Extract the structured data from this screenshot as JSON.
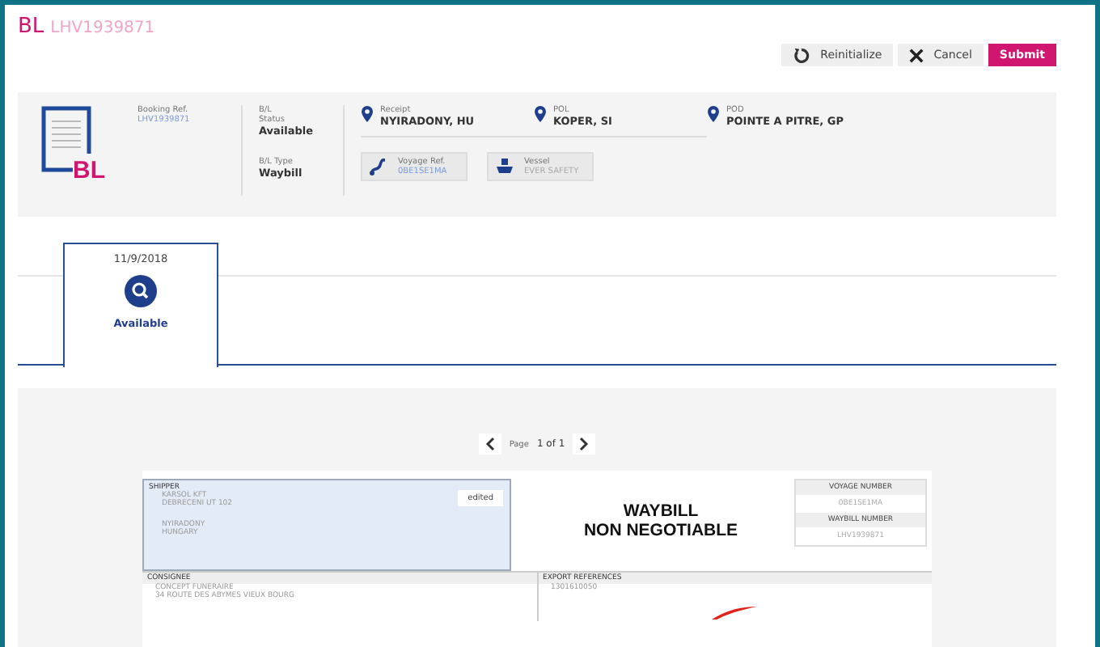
{
  "header": {
    "prefix": "BL",
    "reference": "LHV1939871"
  },
  "actions": [
    {
      "kind": "reset",
      "label": "Reinitialize"
    },
    {
      "kind": "cancel",
      "label": "Cancel"
    },
    {
      "kind": "submit",
      "label": "Submit"
    }
  ],
  "summary": {
    "icon_text": "BL",
    "booking_ref": {
      "label": "Booking Ref.",
      "value": "LHV1939871"
    },
    "status": {
      "label": "B/L\nStatus",
      "value": "Available"
    },
    "type": {
      "label": "B/L Type",
      "value": "Waybill"
    },
    "places": [
      {
        "label": "Receipt",
        "value": "NYIRADONY, HU"
      },
      {
        "label": "POL",
        "value": "KOPER, SI"
      },
      {
        "label": "POD",
        "value": "POINTE A PITRE, GP"
      }
    ],
    "voyage": {
      "label": "Voyage Ref.",
      "value": "0BE1SE1MA"
    },
    "vessel": {
      "label": "Vessel",
      "value": "EVER SAFETY"
    }
  },
  "timeline": [
    {
      "date": "11/9/2018",
      "status": "Available",
      "selected": true
    }
  ],
  "pager": {
    "label": "Page",
    "value": "1 of 1"
  },
  "document": {
    "shipper": {
      "label": "SHIPPER",
      "blocks": [
        [
          "KARSOL KFT",
          "DEBRECENI UT 102"
        ],
        [
          "NYIRADONY",
          "HUNGARY"
        ]
      ],
      "badge": "edited"
    },
    "title_lines": [
      "WAYBILL",
      "NON NEGOTIABLE"
    ],
    "voyage_number": {
      "label": "VOYAGE NUMBER",
      "value": "0BE1SE1MA"
    },
    "waybill_number": {
      "label": "WAYBILL NUMBER",
      "value": "LHV1939871"
    },
    "consignee": {
      "label": "CONSIGNEE",
      "lines": [
        "CONCEPT FUNERAIRE",
        "34 ROUTE DES ABYMES VIEUX BOURG"
      ]
    },
    "export_references": {
      "label": "EXPORT REFERENCES",
      "value": "1301610050"
    }
  }
}
